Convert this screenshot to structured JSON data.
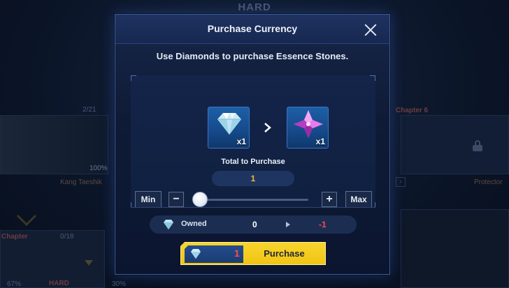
{
  "background": {
    "difficulty_top": "HARD",
    "difficulty_bottom": "HARD",
    "left_card": {
      "progress": "2/21",
      "percent": "100%",
      "name": "Kang Taeshik"
    },
    "right_card": {
      "title": "Chapter 6",
      "name": "Protector"
    },
    "lower_left": {
      "title": "Chapter",
      "progress": "0/18",
      "percent_a": "67%",
      "percent_b": "30%"
    }
  },
  "dialog": {
    "title": "Purchase Currency",
    "subtitle": "Use Diamonds to purchase Essence Stones.",
    "source_item": {
      "icon": "diamond-icon",
      "quantity": "x1"
    },
    "target_item": {
      "icon": "essence-stone-icon",
      "quantity": "x1"
    },
    "total_label": "Total to Purchase",
    "total_value": "1",
    "controls": {
      "min_label": "Min",
      "max_label": "Max",
      "minus": "−",
      "plus": "+"
    },
    "slider": {
      "value": 1,
      "min": 1,
      "max": 100,
      "fraction": 0.0
    },
    "owned": {
      "label": "Owned",
      "current": "0",
      "after": "-1"
    },
    "purchase": {
      "cost": "1",
      "label": "Purchase"
    }
  },
  "colors": {
    "accent_gold": "#f0c414",
    "value_gold": "#f0b83c",
    "negative_red": "#ff4a4a",
    "panel_blue": "#10203f"
  }
}
